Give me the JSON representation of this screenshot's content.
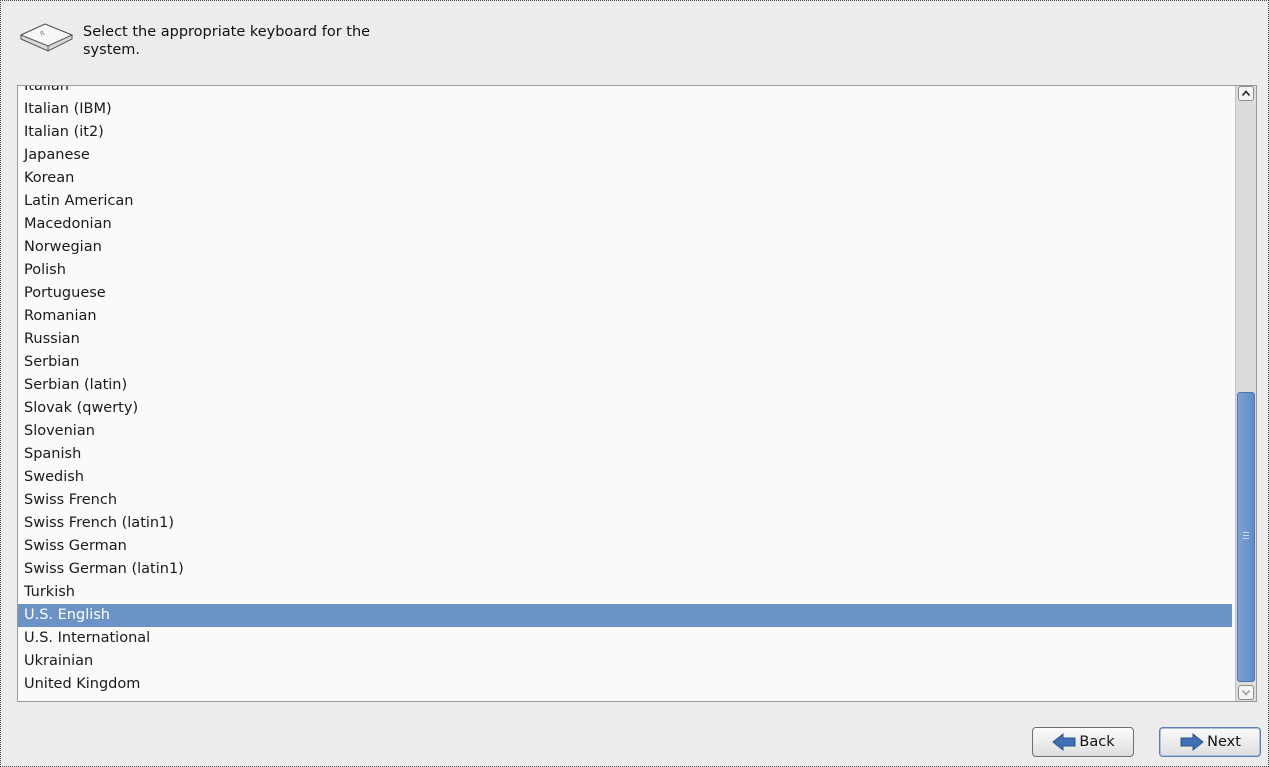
{
  "header": {
    "instruction": "Select the appropriate keyboard for the system.",
    "icon": "keyboard-key-icon"
  },
  "keyboard_list": {
    "items": [
      "Italian",
      "Italian (IBM)",
      "Italian (it2)",
      "Japanese",
      "Korean",
      "Latin American",
      "Macedonian",
      "Norwegian",
      "Polish",
      "Portuguese",
      "Romanian",
      "Russian",
      "Serbian",
      "Serbian (latin)",
      "Slovak (qwerty)",
      "Slovenian",
      "Spanish",
      "Swedish",
      "Swiss French",
      "Swiss French (latin1)",
      "Swiss German",
      "Swiss German (latin1)",
      "Turkish",
      "U.S. English",
      "U.S. International",
      "Ukrainian",
      "United Kingdom"
    ],
    "selected": "U.S. English"
  },
  "footer": {
    "back_label": "Back",
    "next_label": "Next",
    "back_icon": "arrow-left-icon",
    "next_icon": "arrow-right-icon"
  },
  "colors": {
    "selection": "#6c93c6",
    "scroll_thumb": "#6f97cc",
    "arrow": "#3f6fb5"
  }
}
